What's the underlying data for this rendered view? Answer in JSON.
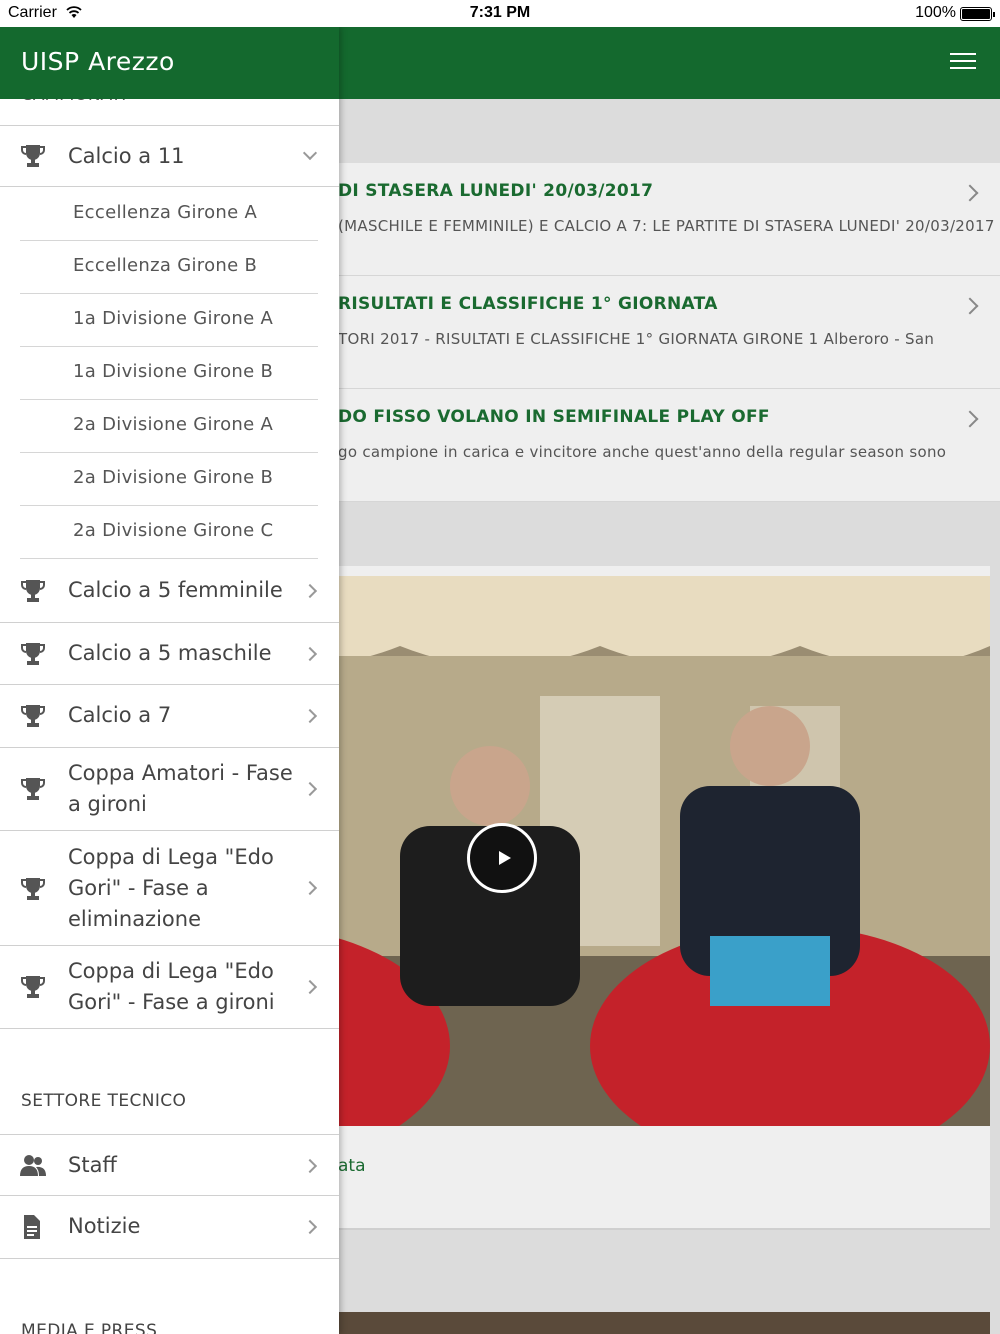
{
  "status_bar": {
    "carrier": "Carrier",
    "time": "7:31 PM",
    "battery": "100%"
  },
  "drawer": {
    "title": "UISP Arezzo",
    "cut_section_header": "CAMPIONATI",
    "expanded_item": {
      "label": "Calcio a 11",
      "icon": "trophy-icon"
    },
    "sub_items": [
      "Eccellenza Girone A",
      "Eccellenza Girone B",
      "1a Divisione Girone A",
      "1a Divisione Girone B",
      "2a Divisione Girone A",
      "2a Divisione Girone B",
      "2a Divisione Girone C"
    ],
    "items": [
      {
        "label": "Calcio a 5 femminile",
        "icon": "trophy-icon"
      },
      {
        "label": "Calcio a 5 maschile",
        "icon": "trophy-icon"
      },
      {
        "label": "Calcio a 7",
        "icon": "trophy-icon"
      },
      {
        "label": "Coppa Amatori - Fase a gironi",
        "icon": "trophy-icon"
      },
      {
        "label": "Coppa di Lega \"Edo Gori\" - Fase a eliminazione",
        "icon": "trophy-icon"
      },
      {
        "label": "Coppa di Lega \"Edo Gori\" - Fase a gironi",
        "icon": "trophy-icon"
      }
    ],
    "section_tecnico": "SETTORE TECNICO",
    "tecnico_items": [
      {
        "label": "Staff",
        "icon": "people-icon"
      },
      {
        "label": "Notizie",
        "icon": "document-icon"
      }
    ],
    "section_media": "MEDIA E PRESS"
  },
  "background": {
    "news": [
      {
        "title": "DI STASERA LUNEDI' 20/03/2017",
        "desc": "(MASCHILE E FEMMINILE) E CALCIO A 7: LE PARTITE DI STASERA LUNEDI' 20/03/2017"
      },
      {
        "title": "RISULTATI E CLASSIFICHE 1° GIORNATA",
        "desc": "TORI 2017 - RISULTATI E CLASSIFICHE 1° GIORNATA GIRONE 1 Alberoro - San"
      },
      {
        "title": "DO FISSO VOLANO IN SEMIFINALE PLAY OFF",
        "desc": "go campione in carica e vincitore anche quest'anno della regular season sono"
      }
    ],
    "video_caption": "ata"
  },
  "colors": {
    "brand_green": "#14692e",
    "link_green": "#1a6a30"
  }
}
